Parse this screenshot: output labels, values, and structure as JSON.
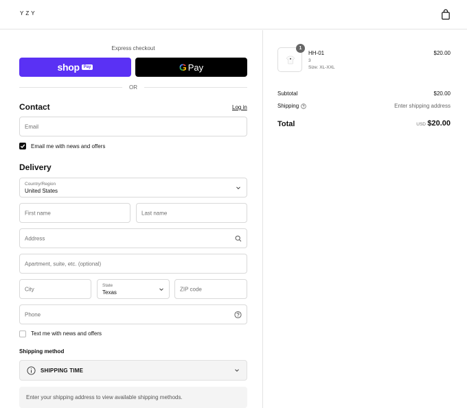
{
  "header": {
    "logo": "YZY",
    "cart_icon": "shopping-bag-icon"
  },
  "express": {
    "label": "Express checkout",
    "shop_pay": {
      "word": "shop",
      "badge": "Pay",
      "color": "#5a31f4"
    },
    "google_pay": {
      "word": "Pay",
      "g": "G",
      "color": "#000000"
    },
    "or": "OR"
  },
  "contact": {
    "heading": "Contact",
    "login": "Log in",
    "email_placeholder": "Email",
    "email_opt_in": "Email me with news and offers",
    "email_opt_in_checked": true
  },
  "delivery": {
    "heading": "Delivery",
    "country_label": "Country/Region",
    "country_value": "United States",
    "first_name": "First name",
    "last_name": "Last name",
    "address": "Address",
    "apartment": "Apartment, suite, etc. (optional)",
    "city": "City",
    "state_label": "State",
    "state_value": "Texas",
    "zip": "ZIP code",
    "phone": "Phone",
    "sms_opt_in": "Text me with news and offers",
    "sms_opt_in_checked": false
  },
  "shipping": {
    "heading": "Shipping method",
    "option_title": "SHIPPING TIME",
    "note": "Enter your shipping address to view available shipping methods."
  },
  "summary": {
    "item": {
      "name": "HH-01",
      "quantity": "1",
      "variant_line1": "3",
      "variant_line2": "Size: XL-XXL",
      "price": "$20.00"
    },
    "subtotal_label": "Subtotal",
    "subtotal_value": "$20.00",
    "shipping_label": "Shipping",
    "shipping_value": "Enter shipping address",
    "total_label": "Total",
    "currency": "USD",
    "total_value": "$20.00"
  }
}
